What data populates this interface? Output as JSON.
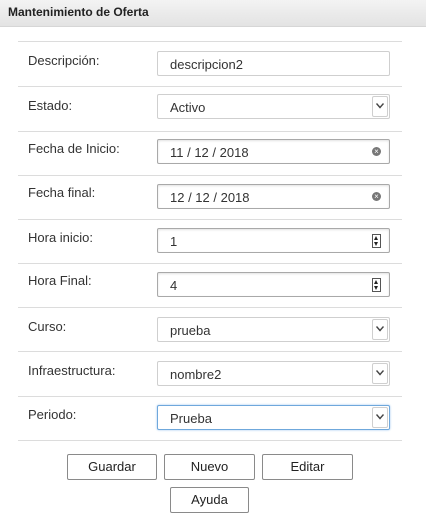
{
  "header": {
    "title": "Mantenimiento de Oferta"
  },
  "form": {
    "descripcion": {
      "label": "Descripción:",
      "value": "descripcion2"
    },
    "estado": {
      "label": "Estado:",
      "value": "Activo"
    },
    "fecha_inicio": {
      "label": "Fecha de Inicio:",
      "value": "11 / 12 / 2018"
    },
    "fecha_final": {
      "label": "Fecha final:",
      "value": "12 / 12 / 2018"
    },
    "hora_inicio": {
      "label": "Hora inicio:",
      "value": "1"
    },
    "hora_final": {
      "label": "Hora Final:",
      "value": "4"
    },
    "curso": {
      "label": "Curso:",
      "value": "prueba"
    },
    "infraestructura": {
      "label": "Infraestructura:",
      "value": "nombre2"
    },
    "periodo": {
      "label": "Periodo:",
      "value": "Prueba"
    }
  },
  "buttons": {
    "guardar": "Guardar",
    "nuevo": "Nuevo",
    "editar": "Editar",
    "ayuda": "Ayuda"
  },
  "icons": {
    "clear": "clear-circle-icon",
    "dropdown": "chevron-down-icon",
    "spinner": "spinner-arrows-icon"
  },
  "colors": {
    "focus_border": "#6fa8dc",
    "separator": "#dcdcdc",
    "header_bg": "#e8e8e8"
  }
}
